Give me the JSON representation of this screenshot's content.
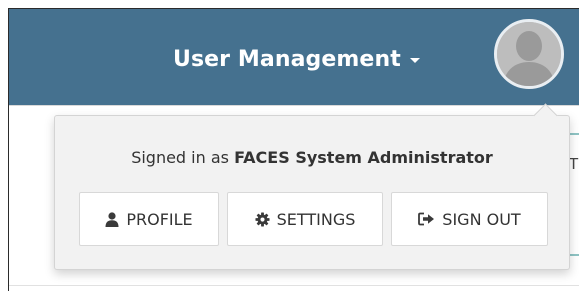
{
  "header": {
    "menu_label": "User Management",
    "background_color": "#45718f"
  },
  "avatar": {
    "icon": "user-avatar-icon"
  },
  "dropdown": {
    "signed_in_prefix": "Signed in as",
    "user_name": "FACES System Administrator",
    "buttons": [
      {
        "label": "PROFILE",
        "icon": "user-icon"
      },
      {
        "label": "SETTINGS",
        "icon": "gear-icon"
      },
      {
        "label": "SIGN OUT",
        "icon": "sign-out-icon"
      }
    ]
  },
  "background": {
    "partial_text": "T"
  }
}
